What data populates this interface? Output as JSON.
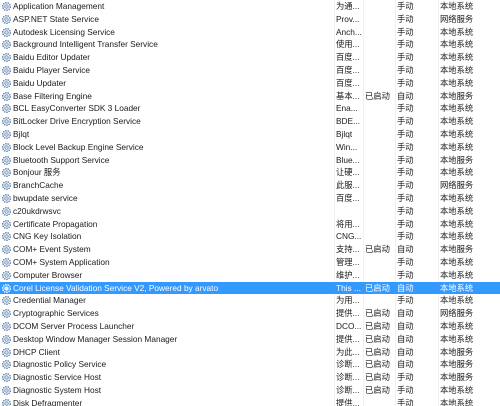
{
  "services": [
    {
      "name": "Application Management",
      "desc": "为通...",
      "status": "",
      "startup": "手动",
      "logon": "本地系统",
      "selected": false
    },
    {
      "name": "ASP.NET State Service",
      "desc": "Prov...",
      "status": "",
      "startup": "手动",
      "logon": "网络服务",
      "selected": false
    },
    {
      "name": "Autodesk Licensing Service",
      "desc": "Anch...",
      "status": "",
      "startup": "手动",
      "logon": "本地系统",
      "selected": false
    },
    {
      "name": "Background Intelligent Transfer Service",
      "desc": "使用...",
      "status": "",
      "startup": "手动",
      "logon": "本地系统",
      "selected": false
    },
    {
      "name": "Baidu Editor Updater",
      "desc": "百度...",
      "status": "",
      "startup": "手动",
      "logon": "本地系统",
      "selected": false
    },
    {
      "name": "Baidu Player Service",
      "desc": "百度...",
      "status": "",
      "startup": "手动",
      "logon": "本地系统",
      "selected": false
    },
    {
      "name": "Baidu Updater",
      "desc": "百度...",
      "status": "",
      "startup": "手动",
      "logon": "本地系统",
      "selected": false
    },
    {
      "name": "Base Filtering Engine",
      "desc": "基本...",
      "status": "已启动",
      "startup": "自动",
      "logon": "本地服务",
      "selected": false
    },
    {
      "name": "BCL EasyConverter SDK 3 Loader",
      "desc": "Ena...",
      "status": "",
      "startup": "手动",
      "logon": "本地系统",
      "selected": false
    },
    {
      "name": "BitLocker Drive Encryption Service",
      "desc": "BDE...",
      "status": "",
      "startup": "手动",
      "logon": "本地系统",
      "selected": false
    },
    {
      "name": "Bjlqt",
      "desc": "Bjlqt",
      "status": "",
      "startup": "手动",
      "logon": "本地系统",
      "selected": false
    },
    {
      "name": "Block Level Backup Engine Service",
      "desc": "Win...",
      "status": "",
      "startup": "手动",
      "logon": "本地系统",
      "selected": false
    },
    {
      "name": "Bluetooth Support Service",
      "desc": "Blue...",
      "status": "",
      "startup": "手动",
      "logon": "本地服务",
      "selected": false
    },
    {
      "name": "Bonjour 服务",
      "desc": "让硬...",
      "status": "",
      "startup": "手动",
      "logon": "本地系统",
      "selected": false
    },
    {
      "name": "BranchCache",
      "desc": "此服...",
      "status": "",
      "startup": "手动",
      "logon": "网络服务",
      "selected": false
    },
    {
      "name": "bwupdate service",
      "desc": "百度...",
      "status": "",
      "startup": "手动",
      "logon": "本地系统",
      "selected": false
    },
    {
      "name": "c20ukdrwsvc",
      "desc": "",
      "status": "",
      "startup": "手动",
      "logon": "本地系统",
      "selected": false
    },
    {
      "name": "Certificate Propagation",
      "desc": "将用...",
      "status": "",
      "startup": "手动",
      "logon": "本地系统",
      "selected": false
    },
    {
      "name": "CNG Key Isolation",
      "desc": "CNG...",
      "status": "",
      "startup": "手动",
      "logon": "本地系统",
      "selected": false
    },
    {
      "name": "COM+ Event System",
      "desc": "支持...",
      "status": "已启动",
      "startup": "自动",
      "logon": "本地服务",
      "selected": false
    },
    {
      "name": "COM+ System Application",
      "desc": "管理...",
      "status": "",
      "startup": "手动",
      "logon": "本地系统",
      "selected": false
    },
    {
      "name": "Computer Browser",
      "desc": "维护...",
      "status": "",
      "startup": "手动",
      "logon": "本地系统",
      "selected": false
    },
    {
      "name": "Corel License Validation Service V2, Powered by arvato",
      "desc": "This ...",
      "status": "已启动",
      "startup": "自动",
      "logon": "本地系统",
      "selected": true
    },
    {
      "name": "Credential Manager",
      "desc": "为用...",
      "status": "",
      "startup": "手动",
      "logon": "本地系统",
      "selected": false
    },
    {
      "name": "Cryptographic Services",
      "desc": "提供...",
      "status": "已启动",
      "startup": "自动",
      "logon": "网络服务",
      "selected": false
    },
    {
      "name": "DCOM Server Process Launcher",
      "desc": "DCO...",
      "status": "已启动",
      "startup": "自动",
      "logon": "本地系统",
      "selected": false
    },
    {
      "name": "Desktop Window Manager Session Manager",
      "desc": "提供...",
      "status": "已启动",
      "startup": "自动",
      "logon": "本地系统",
      "selected": false
    },
    {
      "name": "DHCP Client",
      "desc": "为此...",
      "status": "已启动",
      "startup": "自动",
      "logon": "本地服务",
      "selected": false
    },
    {
      "name": "Diagnostic Policy Service",
      "desc": "诊断...",
      "status": "已启动",
      "startup": "自动",
      "logon": "本地服务",
      "selected": false
    },
    {
      "name": "Diagnostic Service Host",
      "desc": "诊断...",
      "status": "已启动",
      "startup": "手动",
      "logon": "本地服务",
      "selected": false
    },
    {
      "name": "Diagnostic System Host",
      "desc": "诊断...",
      "status": "已启动",
      "startup": "手动",
      "logon": "本地系统",
      "selected": false
    },
    {
      "name": "Disk Defragmenter",
      "desc": "提供...",
      "status": "",
      "startup": "手动",
      "logon": "本地系统",
      "selected": false
    }
  ],
  "colors": {
    "selection": "#3399ff",
    "icon_ring": "#5a7fa8",
    "icon_hub": "#c9d7e6"
  },
  "icon_name": "gear-icon"
}
